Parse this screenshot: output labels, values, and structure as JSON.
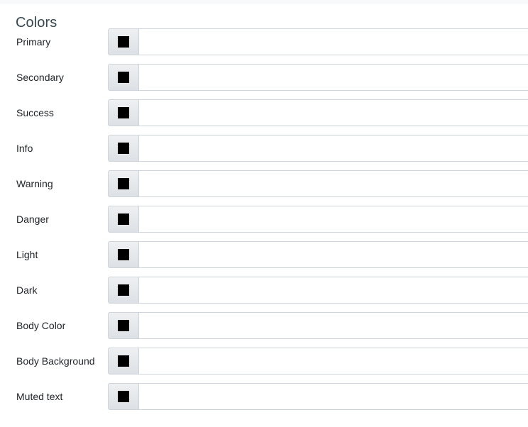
{
  "panel": {
    "title": "Colors"
  },
  "swatch": {
    "icon": "color-swatch-icon",
    "chip_color": "#000000",
    "button_background_top": "#eef0f2",
    "button_background_bottom": "#dde1e5",
    "border_color": "#ced4da"
  },
  "theme": {
    "page_background": "#ffffff",
    "top_strip": "#f8f9fa",
    "title_color": "#37474f",
    "label_color": "#212529",
    "input_border": "#ced4da",
    "input_background": "#ffffff"
  },
  "rows": [
    {
      "label": "Primary",
      "value": "",
      "placeholder": ""
    },
    {
      "label": "Secondary",
      "value": "",
      "placeholder": ""
    },
    {
      "label": "Success",
      "value": "",
      "placeholder": ""
    },
    {
      "label": "Info",
      "value": "",
      "placeholder": ""
    },
    {
      "label": "Warning",
      "value": "",
      "placeholder": ""
    },
    {
      "label": "Danger",
      "value": "",
      "placeholder": ""
    },
    {
      "label": "Light",
      "value": "",
      "placeholder": ""
    },
    {
      "label": "Dark",
      "value": "",
      "placeholder": ""
    },
    {
      "label": "Body Color",
      "value": "",
      "placeholder": ""
    },
    {
      "label": "Body Background",
      "value": "",
      "placeholder": ""
    },
    {
      "label": "Muted text",
      "value": "",
      "placeholder": ""
    }
  ]
}
